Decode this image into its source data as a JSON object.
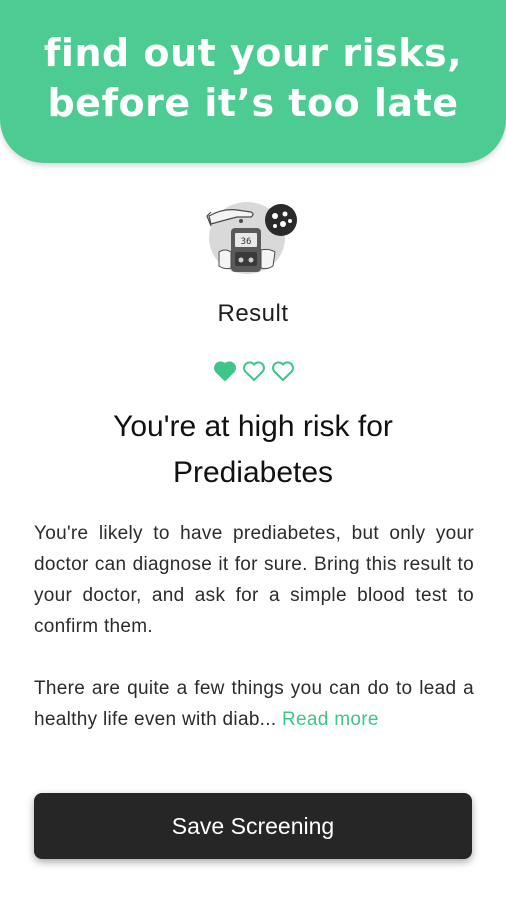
{
  "banner": {
    "line1": "find out your risks,",
    "line2": "before it’s too late"
  },
  "result": {
    "label": "Result",
    "hearts": {
      "filled": 1,
      "total": 3
    },
    "headline_line1": "You're at high risk for",
    "headline_line2": "Prediabetes",
    "paragraph1": "You're likely to have prediabetes, but only your doctor can diagnose it for sure. Bring this result to your doctor, and ask for a simple blood test to confirm them.",
    "paragraph2": "There are quite a few things you can do to lead a healthy life even with diab...",
    "read_more": "Read more"
  },
  "actions": {
    "save_label": "Save Screening"
  },
  "colors": {
    "accent": "#4ccb92",
    "button": "#262626"
  }
}
